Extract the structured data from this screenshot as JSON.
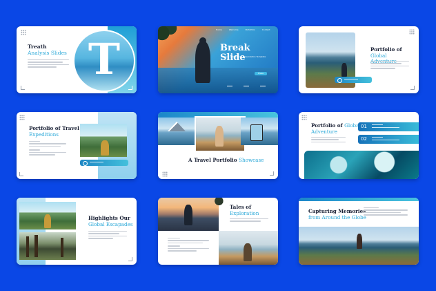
{
  "colors": {
    "background": "#0a47e6",
    "accent": "#2aa8d8",
    "heading": "#1b2236",
    "card": "#ffffff"
  },
  "slides": [
    {
      "title_line1": "Treath",
      "title_line2": "Analysis Slides",
      "big_letter": "T"
    },
    {
      "title": "Break Slide",
      "subtitle": "Travel and Journey Presentation Template",
      "nav": [
        "Home",
        "Welcome",
        "Portofolio",
        "Contact"
      ],
      "button": "Press"
    },
    {
      "title_line1": "Portfolio of",
      "title_line2_hl": "Global",
      "title_line3": "Adventure"
    },
    {
      "title_line1": "Portfolio of Travel",
      "title_line2": "Expeditions"
    },
    {
      "title_plain": "A Travel Portfolio",
      "title_hl": "Showcase"
    },
    {
      "title_line1": "Portfolio of",
      "title_line1_hl": "Global",
      "title_line2": "Adventure",
      "numbers": [
        "01",
        "02"
      ]
    },
    {
      "title_line1": "Highlights Our",
      "title_line2": "Global Escapades"
    },
    {
      "title_line1": "Tales of",
      "title_line2": "Exploration"
    },
    {
      "title_line1": "Capturing Memories",
      "title_line2": "from Around the Globe"
    }
  ],
  "icons": {
    "location": "location-pin-icon",
    "dots": "dot-grid-icon"
  }
}
